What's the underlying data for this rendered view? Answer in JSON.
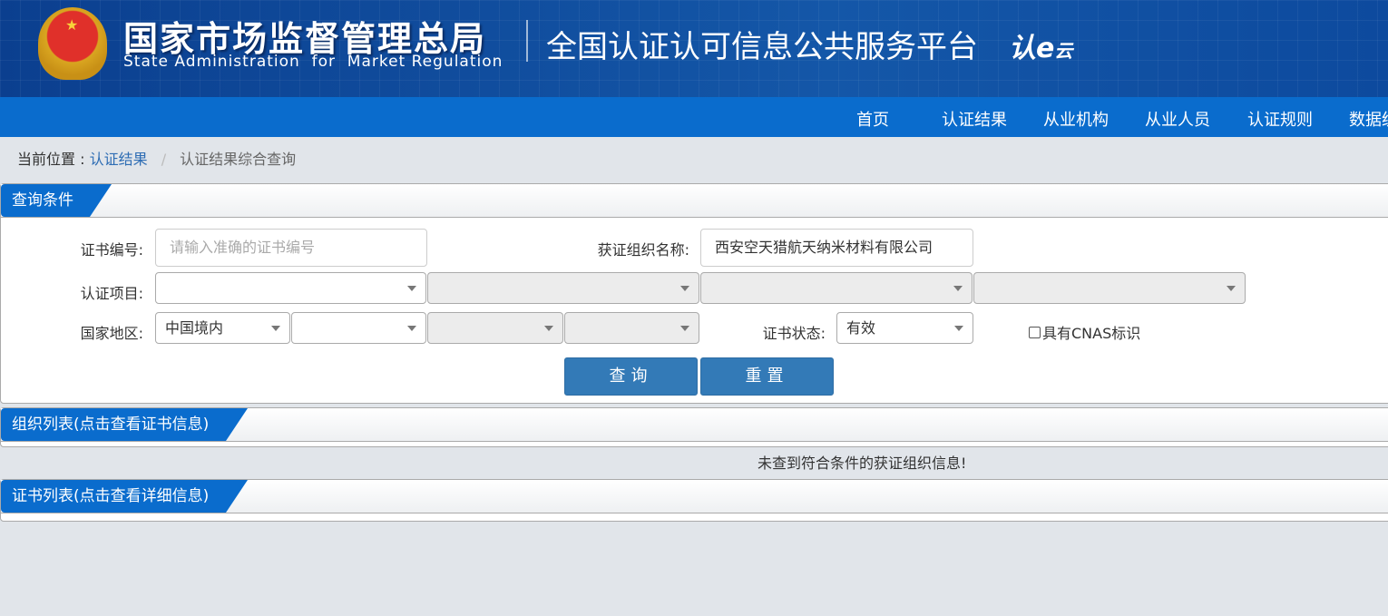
{
  "header": {
    "org_cn": "国家市场监督管理总局",
    "org_en": "State Administration  for  Market Regulation",
    "platform": "全国认证认可信息公共服务平台",
    "logo_text": "认e云"
  },
  "nav": {
    "items": [
      "首页",
      "认证结果",
      "从业机构",
      "从业人员",
      "认证规则",
      "数据统计"
    ]
  },
  "breadcrumb": {
    "prefix": "当前位置 :",
    "link": "认证结果",
    "sep": "/",
    "current": "认证结果综合查询"
  },
  "query": {
    "title": "查询条件",
    "cert_no_label": "证书编号:",
    "cert_no_placeholder": "请输入准确的证书编号",
    "org_label": "获证组织名称:",
    "org_value": "西安空天猎航天纳米材料有限公司",
    "project_label": "认证项目:",
    "region_label": "国家地区:",
    "region_value": "中国境内",
    "status_label": "证书状态:",
    "status_value": "有效",
    "cnas_label": "具有CNAS标识",
    "search_btn": "查询",
    "reset_btn": "重置"
  },
  "org_list": {
    "title": "组织列表(点击查看证书信息)",
    "empty": "未查到符合条件的获证组织信息!"
  },
  "cert_list": {
    "title": "证书列表(点击查看详细信息)"
  },
  "colors": {
    "nav": "#0a6ccd",
    "button": "#337ab7"
  }
}
